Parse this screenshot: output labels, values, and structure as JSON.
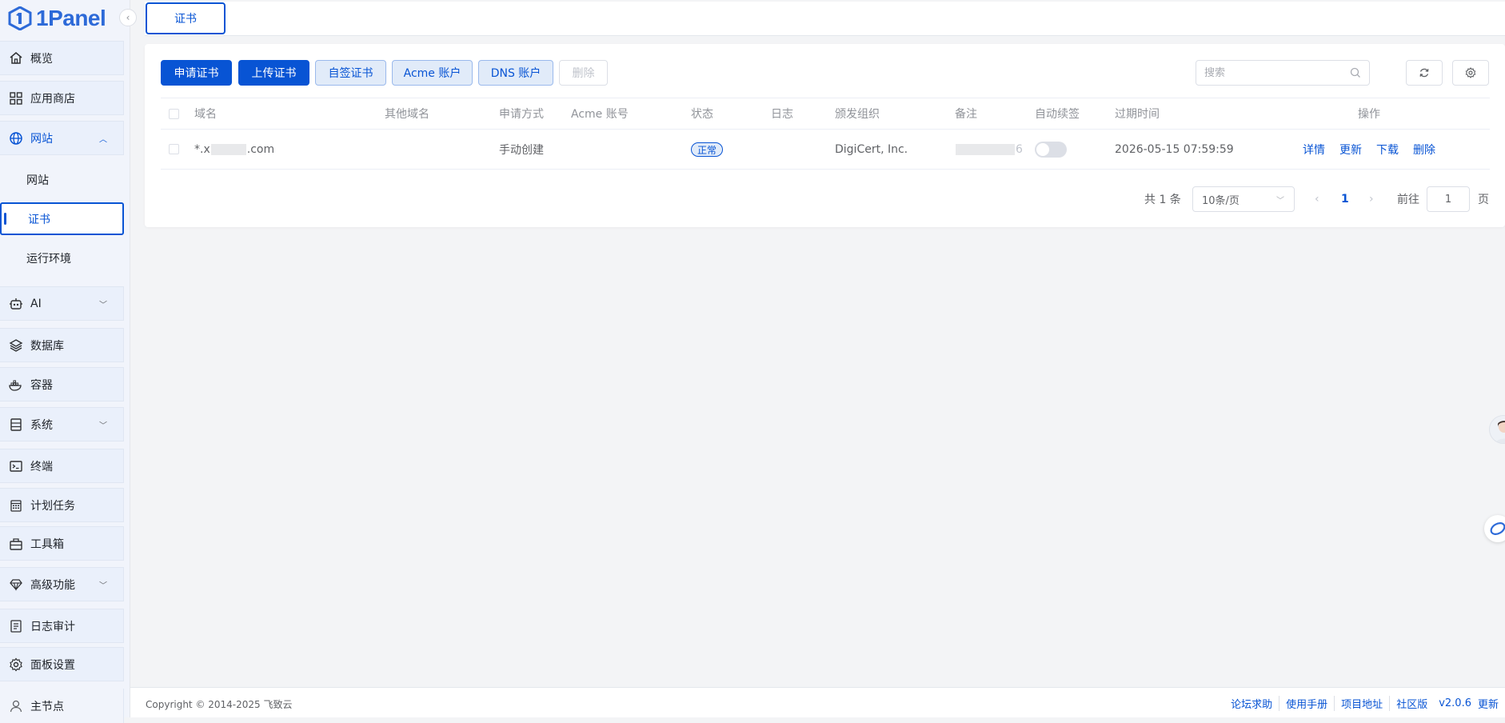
{
  "app": {
    "name": "1Panel"
  },
  "sidebar": {
    "items": [
      {
        "label": "概览",
        "icon": "home-icon"
      },
      {
        "label": "应用商店",
        "icon": "apps-icon"
      },
      {
        "label": "网站",
        "icon": "globe-icon",
        "expanded": true
      },
      {
        "label": "AI",
        "icon": "robot-icon"
      },
      {
        "label": "数据库",
        "icon": "layers-icon"
      },
      {
        "label": "容器",
        "icon": "docker-icon"
      },
      {
        "label": "系统",
        "icon": "server-icon"
      },
      {
        "label": "终端",
        "icon": "terminal-icon"
      },
      {
        "label": "计划任务",
        "icon": "calendar-icon"
      },
      {
        "label": "工具箱",
        "icon": "toolbox-icon"
      },
      {
        "label": "高级功能",
        "icon": "diamond-icon"
      },
      {
        "label": "日志审计",
        "icon": "log-icon"
      },
      {
        "label": "面板设置",
        "icon": "gear-icon"
      },
      {
        "label": "主节点",
        "icon": "user-icon"
      }
    ],
    "website_sub": [
      {
        "label": "网站"
      },
      {
        "label": "证书",
        "active": true
      },
      {
        "label": "运行环境"
      }
    ]
  },
  "tabs": [
    {
      "label": "证书",
      "active": true
    }
  ],
  "toolbar": {
    "apply_cert": "申请证书",
    "upload_cert": "上传证书",
    "self_signed": "自签证书",
    "acme_account": "Acme 账户",
    "dns_account": "DNS 账户",
    "delete": "删除",
    "search_placeholder": "搜索"
  },
  "table": {
    "columns": [
      "域名",
      "其他域名",
      "申请方式",
      "Acme 账号",
      "状态",
      "日志",
      "颁发组织",
      "备注",
      "自动续签",
      "过期时间",
      "操作"
    ],
    "rows": [
      {
        "domain_prefix": "*.x",
        "domain_suffix": ".com",
        "other_domains": "",
        "method": "手动创建",
        "acme_account": "",
        "status": "正常",
        "log": "",
        "issuer": "DigiCert, Inc.",
        "remark_suffix": "6",
        "auto_renew": false,
        "expire_time": "2026-05-15 07:59:59",
        "actions": [
          "详情",
          "更新",
          "下载",
          "删除"
        ]
      }
    ]
  },
  "pagination": {
    "total_text": "共 1 条",
    "page_size": "10条/页",
    "current_page": "1",
    "goto_label": "前往",
    "goto_value": "1",
    "page_unit": "页"
  },
  "footer": {
    "copyright": "Copyright © 2014-2025 飞致云",
    "links": [
      "论坛求助",
      "使用手册",
      "项目地址",
      "社区版"
    ],
    "version": "v2.0.6",
    "update": "更新"
  },
  "colors": {
    "primary": "#0854d4",
    "brand": "#2d6ad8",
    "sidebar_bg": "#f1f4fb"
  }
}
